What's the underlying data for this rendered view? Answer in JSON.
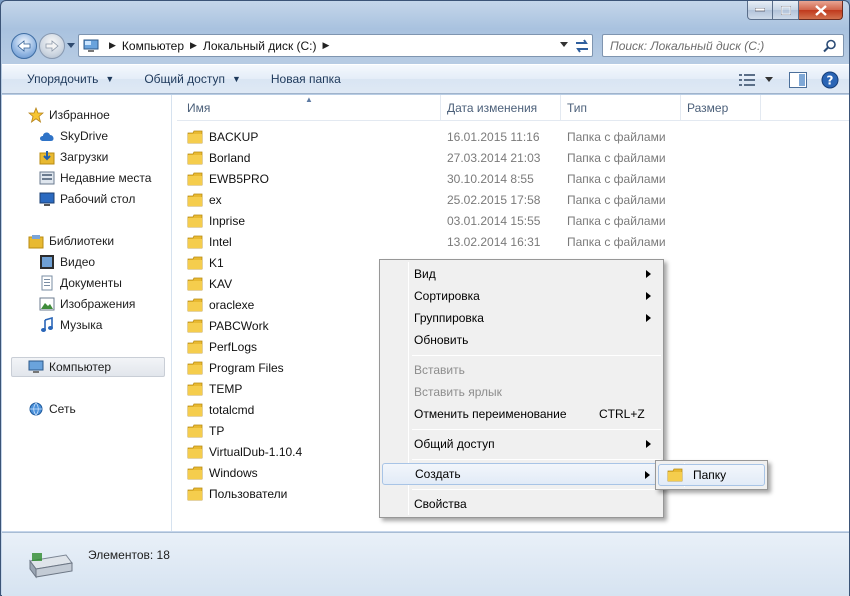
{
  "address": {
    "crumbs": [
      "Компьютер",
      "Локальный диск (C:)"
    ]
  },
  "search": {
    "placeholder": "Поиск: Локальный диск (C:)"
  },
  "toolbar": {
    "organize": "Упорядочить",
    "share": "Общий доступ",
    "new_folder": "Новая папка"
  },
  "nav": {
    "favorites": "Избранное",
    "skydrive": "SkyDrive",
    "downloads": "Загрузки",
    "recent": "Недавние места",
    "desktop": "Рабочий стол",
    "libraries": "Библиотеки",
    "video": "Видео",
    "documents": "Документы",
    "images": "Изображения",
    "music": "Музыка",
    "computer": "Компьютер",
    "network": "Сеть"
  },
  "columns": {
    "name": "Имя",
    "date": "Дата изменения",
    "type": "Тип",
    "size": "Размер"
  },
  "files": [
    {
      "name": "BACKUP",
      "date": "16.01.2015 11:16",
      "type": "Папка с файлами"
    },
    {
      "name": "Borland",
      "date": "27.03.2014 21:03",
      "type": "Папка с файлами"
    },
    {
      "name": "EWB5PRO",
      "date": "30.10.2014 8:55",
      "type": "Папка с файлами"
    },
    {
      "name": "ex",
      "date": "25.02.2015 17:58",
      "type": "Папка с файлами"
    },
    {
      "name": "Inprise",
      "date": "03.01.2014 15:55",
      "type": "Папка с файлами"
    },
    {
      "name": "Intel",
      "date": "13.02.2014 16:31",
      "type": "Папка с файлами"
    },
    {
      "name": "K1",
      "date": "",
      "type": ""
    },
    {
      "name": "KAV",
      "date": "",
      "type": ""
    },
    {
      "name": "oraclexe",
      "date": "",
      "type": ""
    },
    {
      "name": "PABCWork",
      "date": "",
      "type": ""
    },
    {
      "name": "PerfLogs",
      "date": "",
      "type": ""
    },
    {
      "name": "Program Files",
      "date": "",
      "type": ""
    },
    {
      "name": "TEMP",
      "date": "",
      "type": ""
    },
    {
      "name": "totalcmd",
      "date": "",
      "type": ""
    },
    {
      "name": "TP",
      "date": "",
      "type": ""
    },
    {
      "name": "VirtualDub-1.10.4",
      "date": "",
      "type": ""
    },
    {
      "name": "Windows",
      "date": "",
      "type": ""
    },
    {
      "name": "Пользователи",
      "date": "",
      "type": ""
    }
  ],
  "context_menu": {
    "view": "Вид",
    "sort": "Сортировка",
    "group": "Группировка",
    "refresh": "Обновить",
    "paste": "Вставить",
    "paste_shortcut": "Вставить ярлык",
    "undo_rename": "Отменить переименование",
    "undo_shortcut": "CTRL+Z",
    "share": "Общий доступ",
    "create": "Создать",
    "properties": "Свойства"
  },
  "submenu": {
    "folder": "Папку"
  },
  "status": {
    "count": "Элементов: 18"
  },
  "colors": {
    "folder": "#e8b931",
    "highlight_border": "#a8c4e6",
    "disabled_text": "#8d8d8d"
  }
}
